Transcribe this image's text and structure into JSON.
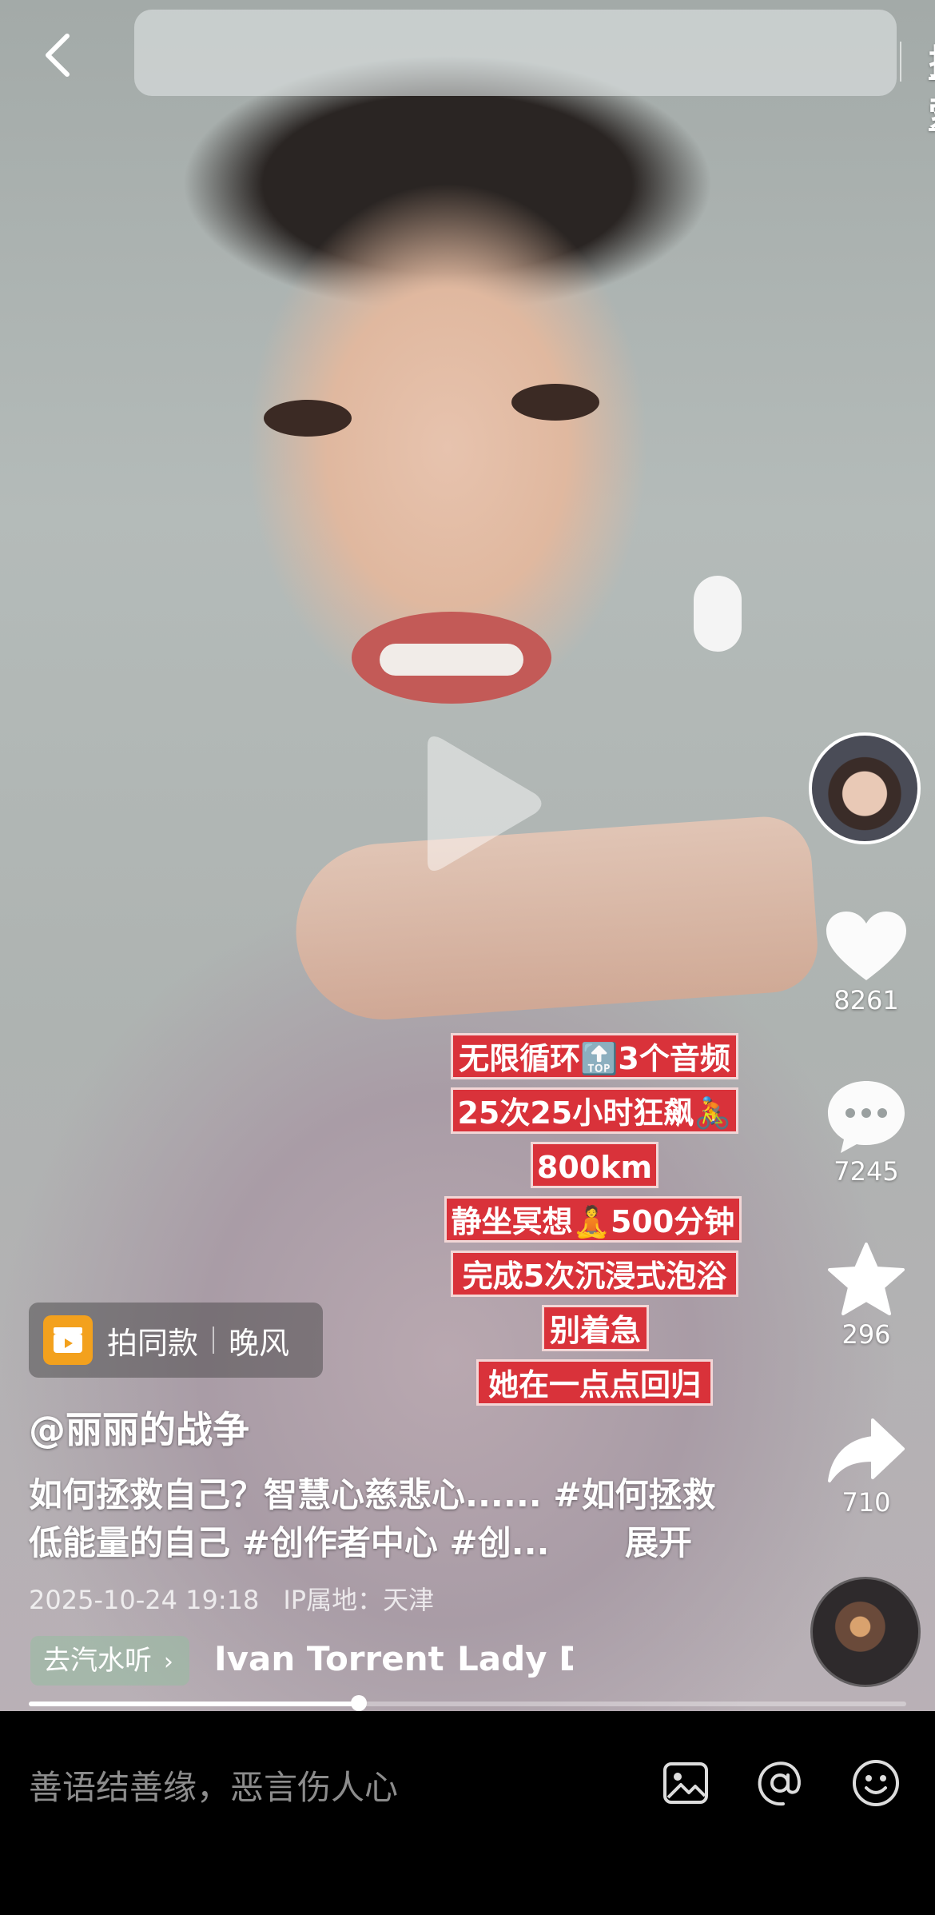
{
  "topbar": {
    "search_button": "搜索"
  },
  "captions": [
    "无限循环🔝3个音频",
    "25次25小时狂飙🚴",
    "800km",
    "静坐冥想🧘500分钟",
    "完成5次沉浸式泡浴",
    "别着急",
    "她在一点点回归"
  ],
  "rail": {
    "likes": "8261",
    "comments": "7245",
    "favorites": "296",
    "shares": "710"
  },
  "same_style": {
    "label": "拍同款",
    "song": "晚风"
  },
  "post": {
    "author": "@丽丽的战争",
    "description": "如何拯救自己？智慧心慈悲心...... #如何拯救低能量的自己 #创作者中心 #创...",
    "expand": "展开",
    "date": "2025-10-24 19:18",
    "ip": "IP属地：天津"
  },
  "music": {
    "listen_label": "去汽水听",
    "track_1": "Ivan Torrent",
    "track_2": "Lady D"
  },
  "progress": {
    "fraction": 0.376
  },
  "comment_bar": {
    "placeholder": "善语结善缘，恶言伤人心"
  },
  "icons": {
    "back": "chevron-left-icon",
    "like": "heart-icon",
    "comment": "comment-bubble-icon",
    "favorite": "star-icon",
    "share": "share-arrow-icon",
    "image": "image-icon",
    "mention": "at-icon",
    "emoji": "emoji-icon"
  },
  "colors": {
    "caption_bg": "#d9323a",
    "same_style_icon": "#f3a11d"
  }
}
